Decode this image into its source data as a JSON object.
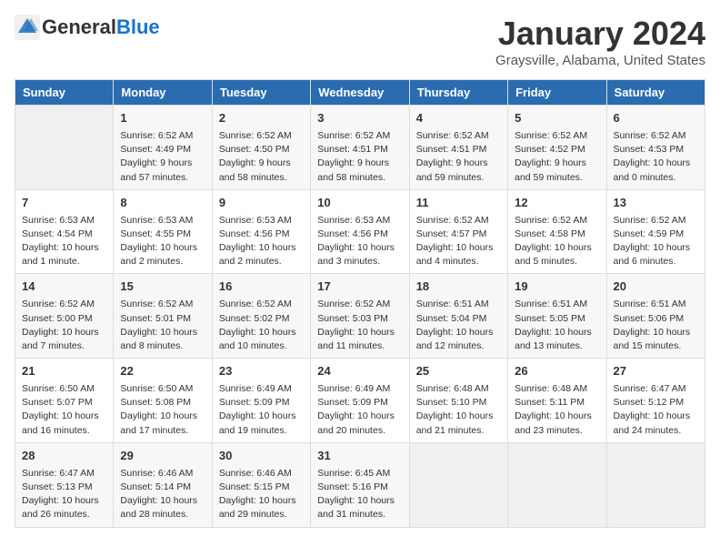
{
  "header": {
    "logo": {
      "general": "General",
      "blue": "Blue"
    },
    "title": "January 2024",
    "subtitle": "Graysville, Alabama, United States"
  },
  "days_of_week": [
    "Sunday",
    "Monday",
    "Tuesday",
    "Wednesday",
    "Thursday",
    "Friday",
    "Saturday"
  ],
  "weeks": [
    [
      {
        "day": "",
        "content": ""
      },
      {
        "day": "1",
        "content": "Sunrise: 6:52 AM\nSunset: 4:49 PM\nDaylight: 9 hours\nand 57 minutes."
      },
      {
        "day": "2",
        "content": "Sunrise: 6:52 AM\nSunset: 4:50 PM\nDaylight: 9 hours\nand 58 minutes."
      },
      {
        "day": "3",
        "content": "Sunrise: 6:52 AM\nSunset: 4:51 PM\nDaylight: 9 hours\nand 58 minutes."
      },
      {
        "day": "4",
        "content": "Sunrise: 6:52 AM\nSunset: 4:51 PM\nDaylight: 9 hours\nand 59 minutes."
      },
      {
        "day": "5",
        "content": "Sunrise: 6:52 AM\nSunset: 4:52 PM\nDaylight: 9 hours\nand 59 minutes."
      },
      {
        "day": "6",
        "content": "Sunrise: 6:52 AM\nSunset: 4:53 PM\nDaylight: 10 hours\nand 0 minutes."
      }
    ],
    [
      {
        "day": "7",
        "content": "Sunrise: 6:53 AM\nSunset: 4:54 PM\nDaylight: 10 hours\nand 1 minute."
      },
      {
        "day": "8",
        "content": "Sunrise: 6:53 AM\nSunset: 4:55 PM\nDaylight: 10 hours\nand 2 minutes."
      },
      {
        "day": "9",
        "content": "Sunrise: 6:53 AM\nSunset: 4:56 PM\nDaylight: 10 hours\nand 2 minutes."
      },
      {
        "day": "10",
        "content": "Sunrise: 6:53 AM\nSunset: 4:56 PM\nDaylight: 10 hours\nand 3 minutes."
      },
      {
        "day": "11",
        "content": "Sunrise: 6:52 AM\nSunset: 4:57 PM\nDaylight: 10 hours\nand 4 minutes."
      },
      {
        "day": "12",
        "content": "Sunrise: 6:52 AM\nSunset: 4:58 PM\nDaylight: 10 hours\nand 5 minutes."
      },
      {
        "day": "13",
        "content": "Sunrise: 6:52 AM\nSunset: 4:59 PM\nDaylight: 10 hours\nand 6 minutes."
      }
    ],
    [
      {
        "day": "14",
        "content": "Sunrise: 6:52 AM\nSunset: 5:00 PM\nDaylight: 10 hours\nand 7 minutes."
      },
      {
        "day": "15",
        "content": "Sunrise: 6:52 AM\nSunset: 5:01 PM\nDaylight: 10 hours\nand 8 minutes."
      },
      {
        "day": "16",
        "content": "Sunrise: 6:52 AM\nSunset: 5:02 PM\nDaylight: 10 hours\nand 10 minutes."
      },
      {
        "day": "17",
        "content": "Sunrise: 6:52 AM\nSunset: 5:03 PM\nDaylight: 10 hours\nand 11 minutes."
      },
      {
        "day": "18",
        "content": "Sunrise: 6:51 AM\nSunset: 5:04 PM\nDaylight: 10 hours\nand 12 minutes."
      },
      {
        "day": "19",
        "content": "Sunrise: 6:51 AM\nSunset: 5:05 PM\nDaylight: 10 hours\nand 13 minutes."
      },
      {
        "day": "20",
        "content": "Sunrise: 6:51 AM\nSunset: 5:06 PM\nDaylight: 10 hours\nand 15 minutes."
      }
    ],
    [
      {
        "day": "21",
        "content": "Sunrise: 6:50 AM\nSunset: 5:07 PM\nDaylight: 10 hours\nand 16 minutes."
      },
      {
        "day": "22",
        "content": "Sunrise: 6:50 AM\nSunset: 5:08 PM\nDaylight: 10 hours\nand 17 minutes."
      },
      {
        "day": "23",
        "content": "Sunrise: 6:49 AM\nSunset: 5:09 PM\nDaylight: 10 hours\nand 19 minutes."
      },
      {
        "day": "24",
        "content": "Sunrise: 6:49 AM\nSunset: 5:09 PM\nDaylight: 10 hours\nand 20 minutes."
      },
      {
        "day": "25",
        "content": "Sunrise: 6:48 AM\nSunset: 5:10 PM\nDaylight: 10 hours\nand 21 minutes."
      },
      {
        "day": "26",
        "content": "Sunrise: 6:48 AM\nSunset: 5:11 PM\nDaylight: 10 hours\nand 23 minutes."
      },
      {
        "day": "27",
        "content": "Sunrise: 6:47 AM\nSunset: 5:12 PM\nDaylight: 10 hours\nand 24 minutes."
      }
    ],
    [
      {
        "day": "28",
        "content": "Sunrise: 6:47 AM\nSunset: 5:13 PM\nDaylight: 10 hours\nand 26 minutes."
      },
      {
        "day": "29",
        "content": "Sunrise: 6:46 AM\nSunset: 5:14 PM\nDaylight: 10 hours\nand 28 minutes."
      },
      {
        "day": "30",
        "content": "Sunrise: 6:46 AM\nSunset: 5:15 PM\nDaylight: 10 hours\nand 29 minutes."
      },
      {
        "day": "31",
        "content": "Sunrise: 6:45 AM\nSunset: 5:16 PM\nDaylight: 10 hours\nand 31 minutes."
      },
      {
        "day": "",
        "content": ""
      },
      {
        "day": "",
        "content": ""
      },
      {
        "day": "",
        "content": ""
      }
    ]
  ]
}
